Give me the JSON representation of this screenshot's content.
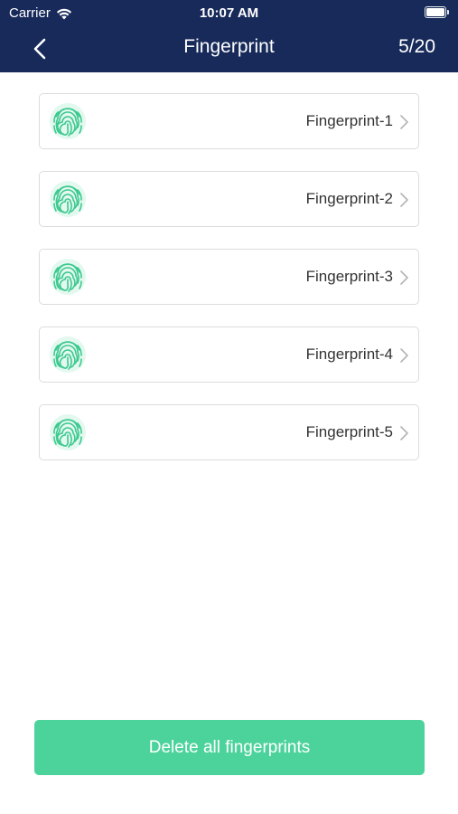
{
  "status_bar": {
    "carrier": "Carrier",
    "time": "10:07 AM",
    "icons": [
      "wifi-icon",
      "battery-icon"
    ]
  },
  "nav": {
    "title": "Fingerprint",
    "count": "5/20",
    "back_icon": "chevron-left-icon"
  },
  "fingerprints": [
    {
      "label": "Fingerprint-1"
    },
    {
      "label": "Fingerprint-2"
    },
    {
      "label": "Fingerprint-3"
    },
    {
      "label": "Fingerprint-4"
    },
    {
      "label": "Fingerprint-5"
    }
  ],
  "actions": {
    "delete_all_label": "Delete all fingerprints"
  },
  "colors": {
    "header_bg": "#172a5a",
    "accent_green": "#4cd39b",
    "item_border": "#dcdcdc",
    "item_text": "#333333"
  }
}
